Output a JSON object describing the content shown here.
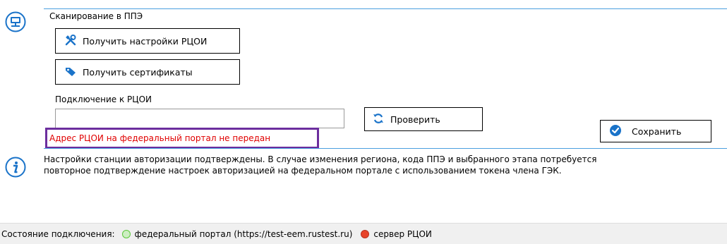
{
  "scan": {
    "title": "Сканирование в ППЭ",
    "icon": "monitor-network-icon"
  },
  "buttons": {
    "get_settings": "Получить настройки РЦОИ",
    "get_certificates": "Получить сертификаты",
    "check": "Проверить",
    "save": "Сохранить"
  },
  "connection": {
    "label": "Подключение к РЦОИ",
    "address_value": "",
    "error": "Адрес РЦОИ на федеральный портал не передан"
  },
  "info": {
    "icon": "info-icon",
    "line1": "Настройки станции авторизации подтверждены. В случае изменения региона, кода ППЭ и выбранного этапа потребуется",
    "line2": "повторное подтверждение настроек авторизацией на федеральном портале с использованием токена члена ГЭК."
  },
  "status": {
    "label": "Состояние подключения:",
    "items": [
      {
        "name": "федеральный портал (https://test-eem.rustest.ru)",
        "state": "connected",
        "color": "#5cc83c"
      },
      {
        "name": "сервер РЦОИ",
        "state": "error",
        "color": "#e8442a"
      }
    ]
  },
  "colors": {
    "accent_line": "#4a9fe0",
    "error_text": "#e00000",
    "error_highlight": "#6c2e9e",
    "icon_blue": "#1a73c9"
  }
}
